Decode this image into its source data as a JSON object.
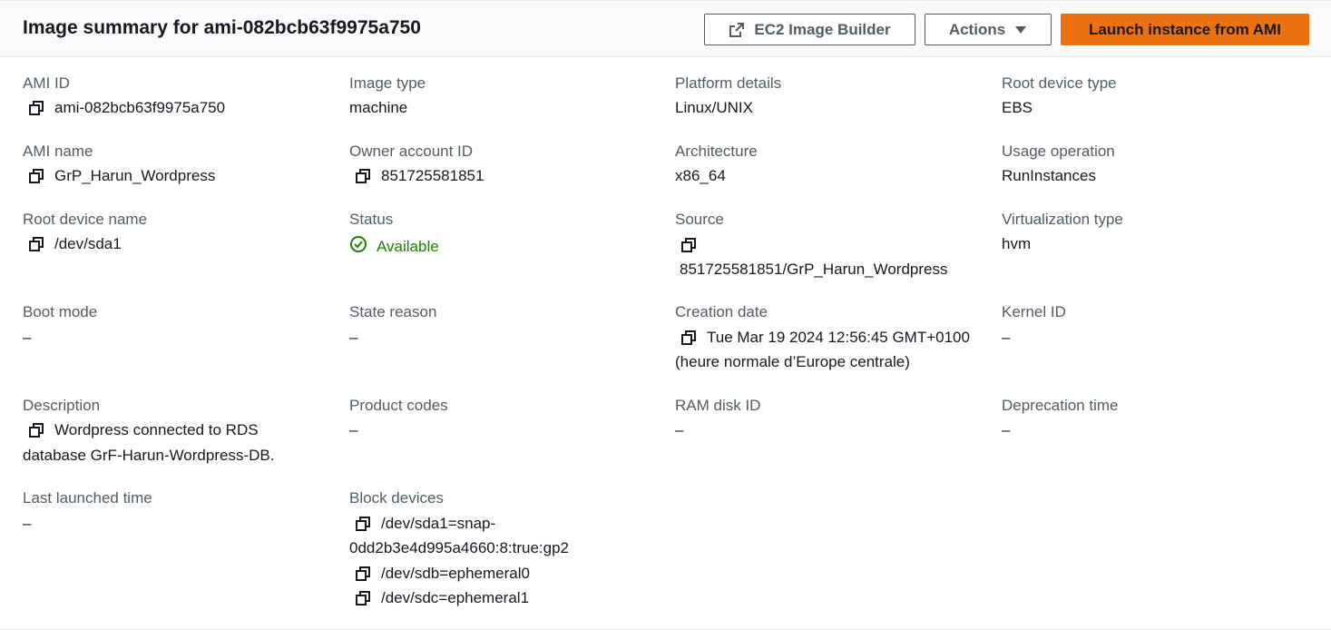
{
  "header": {
    "title": "Image summary for ami-082bcb63f9975a750",
    "buttons": {
      "image_builder": "EC2 Image Builder",
      "actions": "Actions",
      "launch": "Launch instance from AMI"
    }
  },
  "colors": {
    "primary_button": "#ec7211",
    "status_available": "#1d8102",
    "label": "#545b64",
    "text": "#16191f"
  },
  "icons": {
    "copy": "copy-icon",
    "external": "external-link-icon",
    "caret": "caret-down-icon",
    "status": "status-check-icon"
  },
  "fields": {
    "ami_id": {
      "label": "AMI ID",
      "value": "ami-082bcb63f9975a750"
    },
    "image_type": {
      "label": "Image type",
      "value": "machine"
    },
    "platform_details": {
      "label": "Platform details",
      "value": "Linux/UNIX"
    },
    "root_device_type": {
      "label": "Root device type",
      "value": "EBS"
    },
    "ami_name": {
      "label": "AMI name",
      "value": "GrP_Harun_Wordpress"
    },
    "owner_account_id": {
      "label": "Owner account ID",
      "value": "851725581851"
    },
    "architecture": {
      "label": "Architecture",
      "value": "x86_64"
    },
    "usage_operation": {
      "label": "Usage operation",
      "value": "RunInstances"
    },
    "root_device_name": {
      "label": "Root device name",
      "value": "/dev/sda1"
    },
    "status": {
      "label": "Status",
      "value": "Available"
    },
    "source": {
      "label": "Source",
      "value": "851725581851/GrP_Harun_Wordpress"
    },
    "virtualization_type": {
      "label": "Virtualization type",
      "value": "hvm"
    },
    "boot_mode": {
      "label": "Boot mode",
      "value": "–"
    },
    "state_reason": {
      "label": "State reason",
      "value": "–"
    },
    "creation_date": {
      "label": "Creation date",
      "value_line1": "Tue Mar 19 2024 12:56:45 GMT+0100",
      "value_line2": "(heure normale d’Europe centrale)"
    },
    "kernel_id": {
      "label": "Kernel ID",
      "value": "–"
    },
    "description": {
      "label": "Description",
      "value_line1": "Wordpress connected to RDS",
      "value_line2": "database GrF-Harun-Wordpress-DB."
    },
    "product_codes": {
      "label": "Product codes",
      "value": "–"
    },
    "ram_disk_id": {
      "label": "RAM disk ID",
      "value": "–"
    },
    "deprecation_time": {
      "label": "Deprecation time",
      "value": "–"
    },
    "last_launched_time": {
      "label": "Last launched time",
      "value": "–"
    },
    "block_devices": {
      "label": "Block devices",
      "items": [
        {
          "line1": "/dev/sda1=snap-",
          "line2": "0dd2b3e4d995a4660:8:true:gp2"
        },
        {
          "line1": "/dev/sdb=ephemeral0"
        },
        {
          "line1": "/dev/sdc=ephemeral1"
        }
      ]
    }
  }
}
